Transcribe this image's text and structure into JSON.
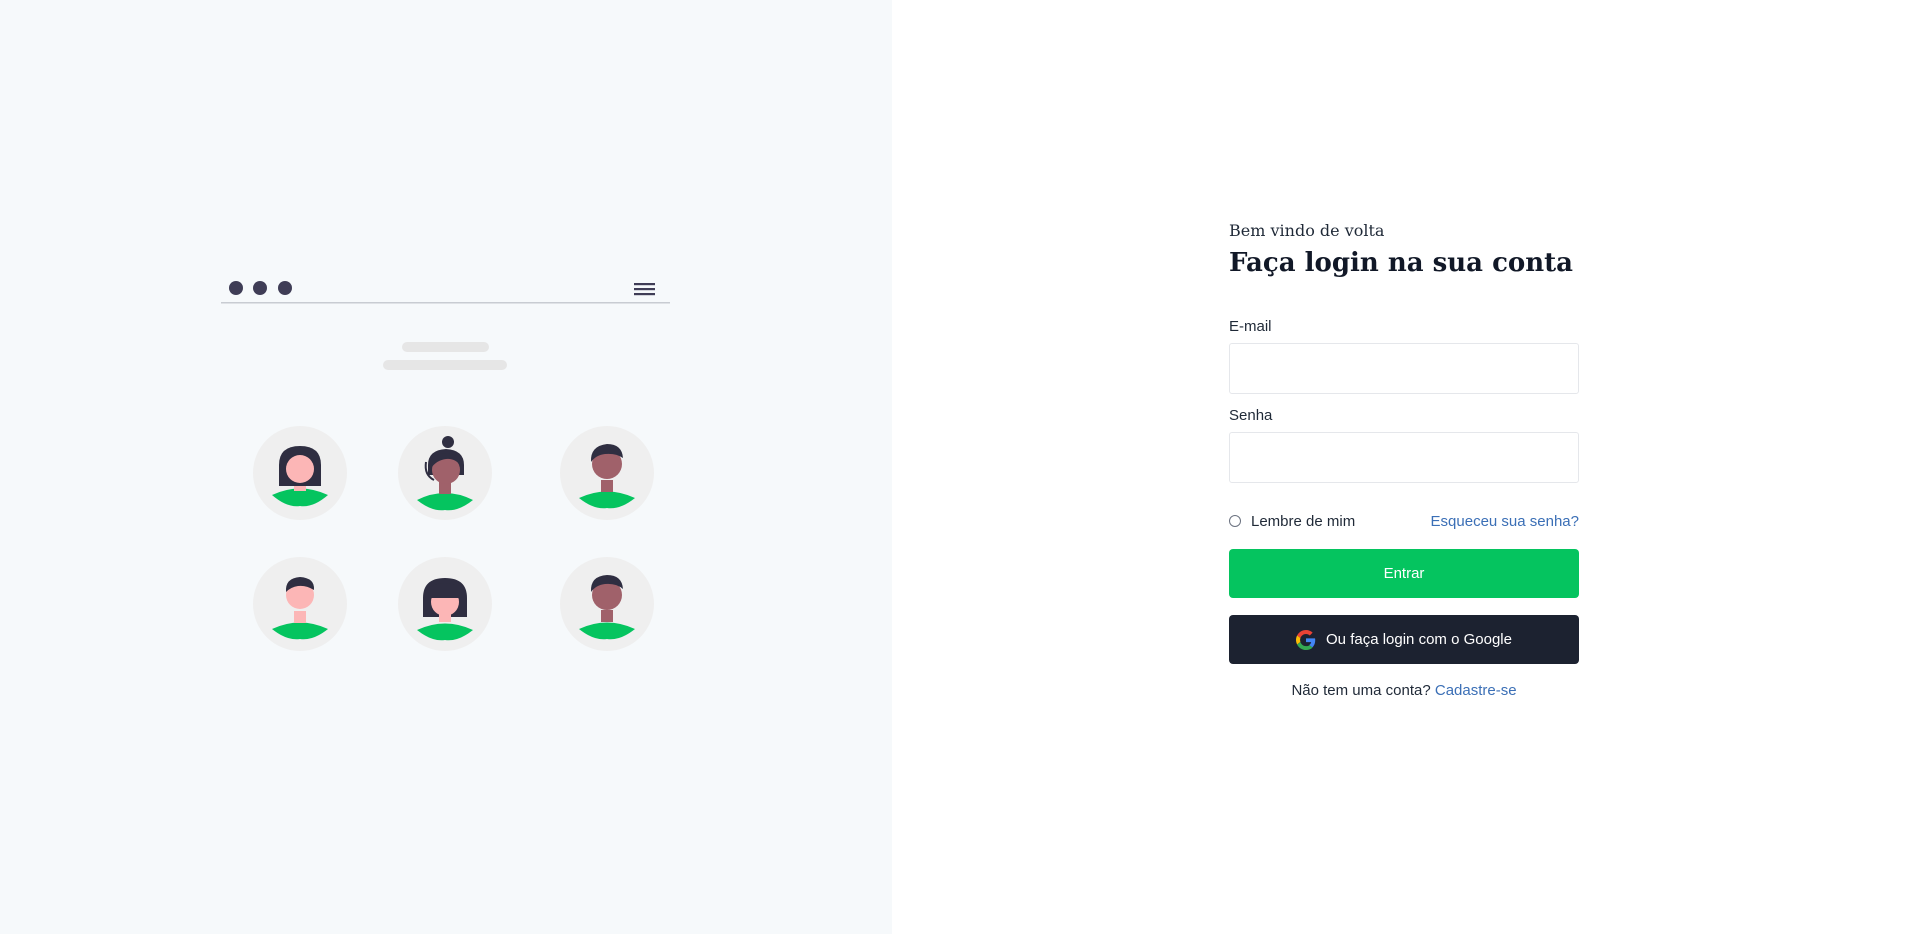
{
  "illustration": {
    "menu_icon": "hamburger-menu-icon",
    "window_dots_icon": "window-dots-icon",
    "avatars": [
      "avatar-woman-bob",
      "avatar-woman-bun",
      "avatar-man-dark",
      "avatar-man-light",
      "avatar-woman-bangs",
      "avatar-man-curly"
    ],
    "colors": {
      "panel_bg": "#f6f9fb",
      "avatar_circle": "#efefef",
      "shirt": "#05c45f",
      "hair": "#2f2e41"
    }
  },
  "login": {
    "welcome": "Bem vindo de volta",
    "title": "Faça login na sua conta",
    "email_label": "E-mail",
    "email_value": "",
    "password_label": "Senha",
    "password_value": "",
    "remember_label": "Lembre de mim",
    "forgot_link": "Esqueceu sua senha?",
    "submit_label": "Entrar",
    "google_label": "Ou faça login com o Google",
    "google_icon": "google-icon",
    "no_account_text": "Não tem uma conta?",
    "signup_link": "Cadastre-se"
  },
  "colors": {
    "primary": "#05c45f",
    "google_button": "#1c2230",
    "link": "#3b6fb6"
  }
}
